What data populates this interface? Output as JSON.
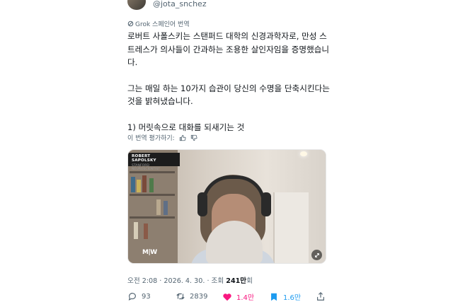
{
  "author": {
    "handle": "@jota_snchez"
  },
  "translation": {
    "label": "Grok 스페인어 번역",
    "rate_label": "이 번역 평가하기:"
  },
  "tweet": {
    "lines": [
      "로버트 사폴스키는 스탠퍼드 대학의 신경과학자로, 만성 스트레스가 의사들이 간과하는 조용한 살인자임을 증명했습니다.",
      "그는 매일 하는 10가지 습관이 당신의 수명을 단축시킨다는 것을 밝혀냈습니다.",
      "1) 머릿속으로 대화를 되새기는 것"
    ]
  },
  "media": {
    "caption_name": "ROBERT SAPOLSKY",
    "caption_sub": "STANFORD NEUROSCIENTIST",
    "watermark": "M|W"
  },
  "meta": {
    "time": "오전 2:08",
    "date": "2026. 4. 30.",
    "views_label": "조회",
    "views_count": "241만",
    "views_suffix": "회"
  },
  "actions": {
    "replies": "93",
    "retweets": "2839",
    "likes": "1.4만",
    "bookmarks": "1.6만"
  },
  "colors": {
    "like": "#f91880",
    "bookmark": "#1d9bf0",
    "muted": "#536471"
  }
}
